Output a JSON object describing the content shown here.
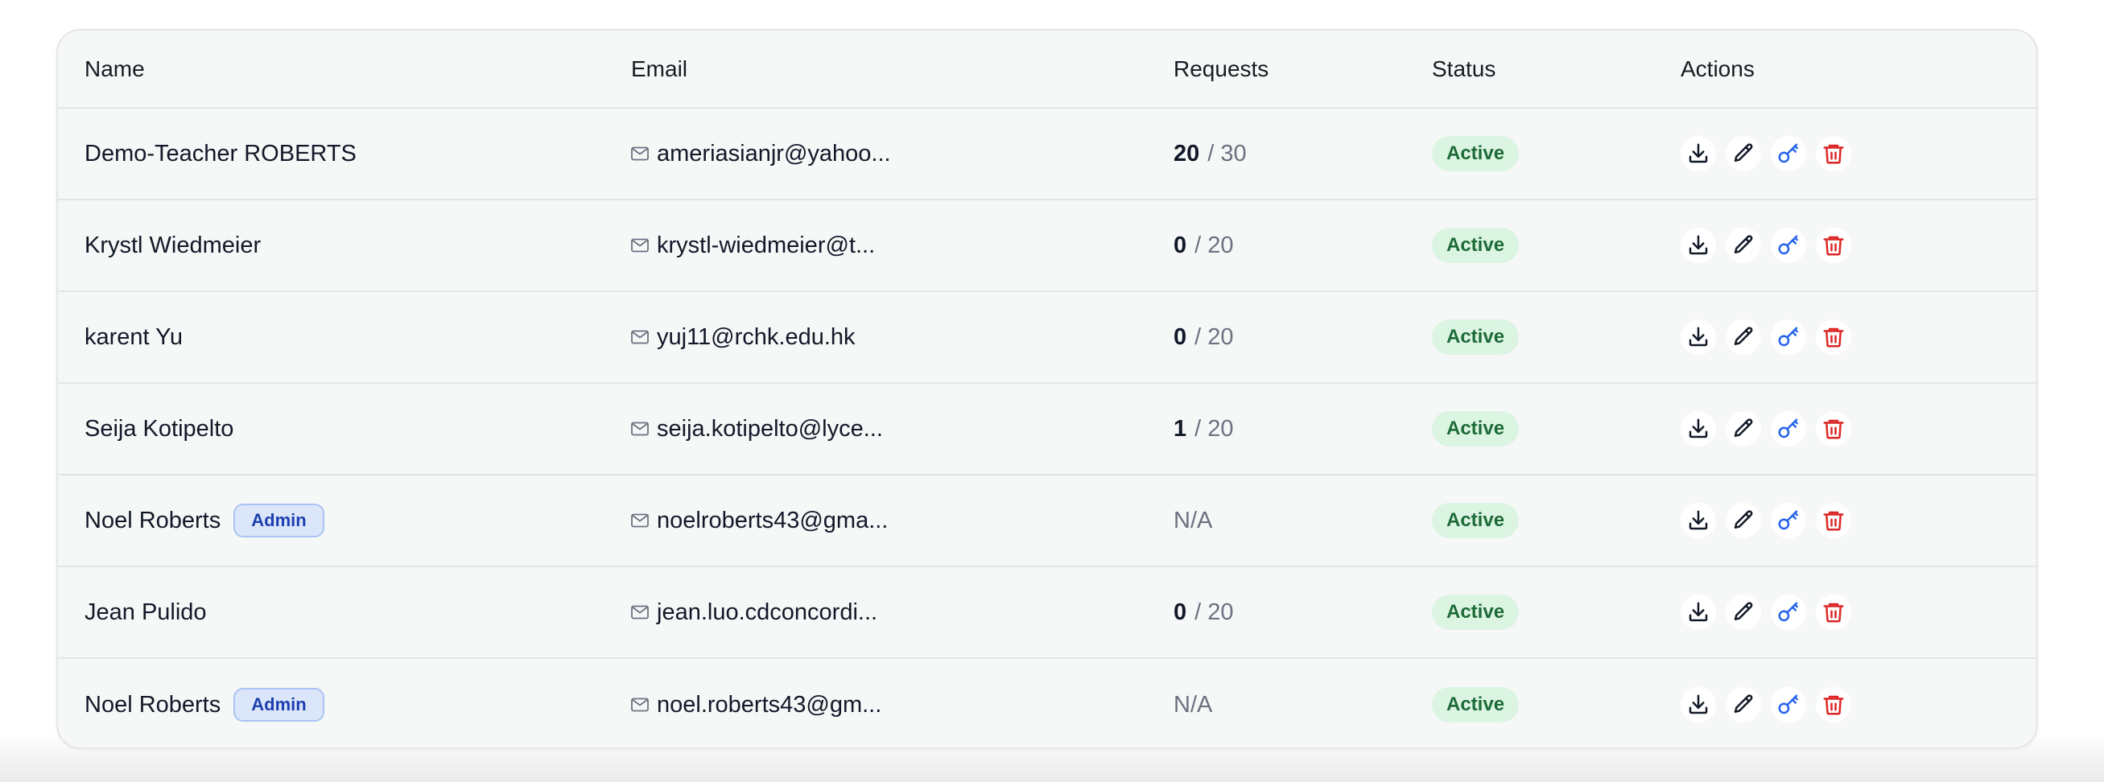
{
  "table": {
    "headers": {
      "name": "Name",
      "email": "Email",
      "requests": "Requests",
      "status": "Status",
      "actions": "Actions"
    },
    "rows": [
      {
        "name": "Demo-Teacher ROBERTS",
        "badge": "",
        "email": "ameriasianjr@yahoo...",
        "requests_used": "20",
        "requests_limit": "30",
        "requests_text": "",
        "status": "Active"
      },
      {
        "name": "Krystl Wiedmeier",
        "badge": "",
        "email": "krystl-wiedmeier@t...",
        "requests_used": "0",
        "requests_limit": "20",
        "requests_text": "",
        "status": "Active"
      },
      {
        "name": "karent Yu",
        "badge": "",
        "email": "yuj11@rchk.edu.hk",
        "requests_used": "0",
        "requests_limit": "20",
        "requests_text": "",
        "status": "Active"
      },
      {
        "name": "Seija Kotipelto",
        "badge": "",
        "email": "seija.kotipelto@lyce...",
        "requests_used": "1",
        "requests_limit": "20",
        "requests_text": "",
        "status": "Active"
      },
      {
        "name": "Noel Roberts",
        "badge": "Admin",
        "email": "noelroberts43@gma...",
        "requests_used": "",
        "requests_limit": "",
        "requests_text": "N/A",
        "status": "Active"
      },
      {
        "name": "Jean Pulido",
        "badge": "",
        "email": "jean.luo.cdconcordi...",
        "requests_used": "0",
        "requests_limit": "20",
        "requests_text": "",
        "status": "Active"
      },
      {
        "name": "Noel Roberts",
        "badge": "Admin",
        "email": "noel.roberts43@gm...",
        "requests_used": "",
        "requests_limit": "",
        "requests_text": "N/A",
        "status": "Active"
      }
    ],
    "requests_separator": "/",
    "action_icons": [
      "download-icon",
      "pencil-icon",
      "key-icon",
      "trash-icon"
    ]
  },
  "colors": {
    "admin_badge_bg": "#dbe6fb",
    "admin_badge_text": "#1e40af",
    "status_active_bg": "#dcf5e3",
    "status_active_text": "#1d6b37",
    "key_icon": "#2563eb",
    "trash_icon": "#dc2626"
  }
}
